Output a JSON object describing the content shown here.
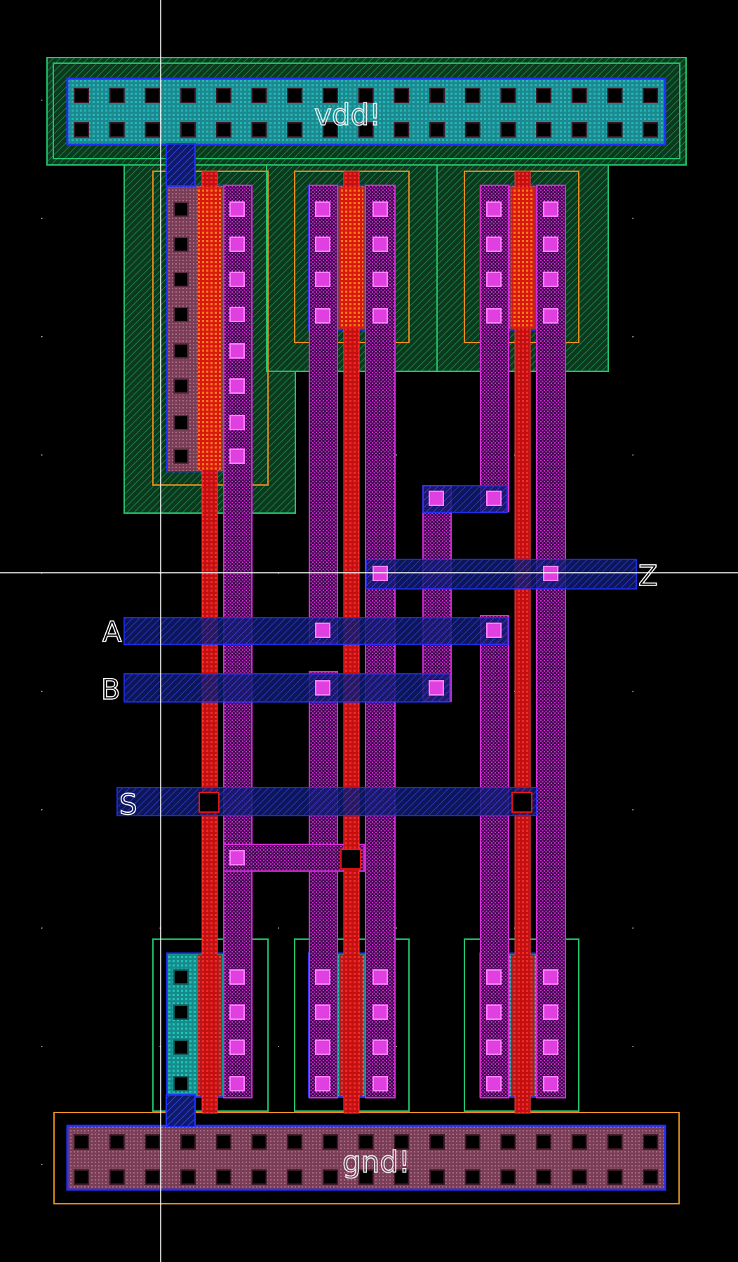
{
  "canvas": {
    "background": "#000000",
    "grid_dot_color": "#dcdcdc",
    "crosshair_color": "#ffffff"
  },
  "rails": {
    "vdd": {
      "label": "vdd!"
    },
    "gnd": {
      "label": "gnd!"
    }
  },
  "pins": {
    "A": {
      "label": "A"
    },
    "B": {
      "label": "B"
    },
    "S": {
      "label": "S"
    },
    "Z": {
      "label": "Z"
    }
  },
  "layer_colors": {
    "nwell": "#22c06a",
    "pselect": "#e08a1e",
    "nselect": "#1fd16a",
    "active_p": "#8a4a62",
    "active_n": "#1fb5b0",
    "poly": "#e01414",
    "metal1": "#c020c0",
    "metal2": "#2030ff",
    "contact": "#000000",
    "via": "#e040e0"
  },
  "transistors": {
    "pmos_count": 3,
    "nmos_count": 3
  }
}
